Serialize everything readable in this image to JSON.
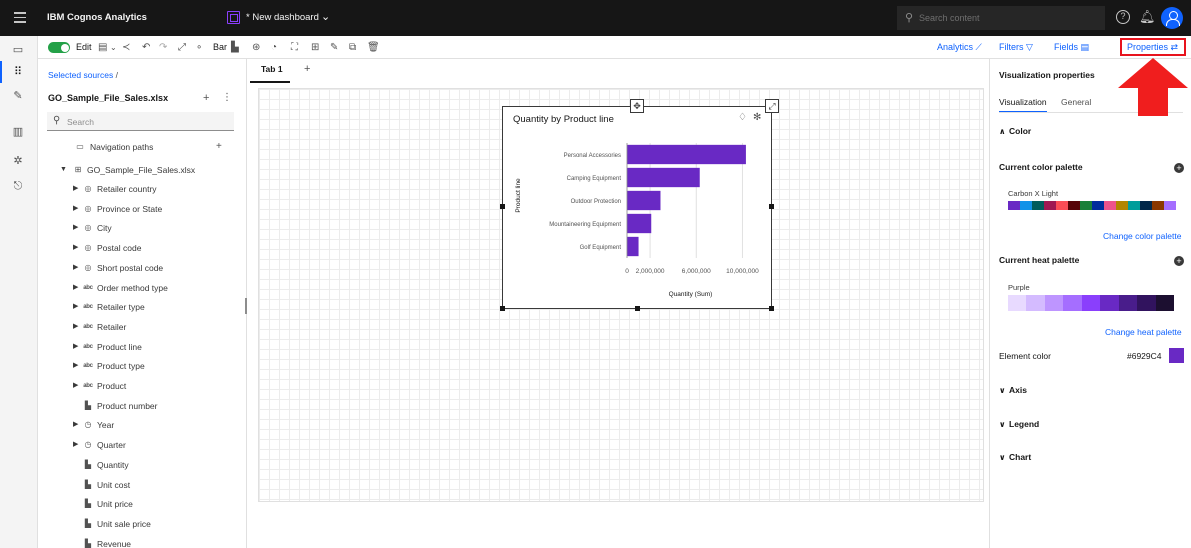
{
  "app": {
    "title": "IBM Cognos Analytics",
    "dashboard_name": "* New dashboard",
    "search_placeholder": "Search content"
  },
  "toolbar": {
    "edit_label": "Edit",
    "bar_label": "Bar",
    "analytics_label": "Analytics",
    "filters_label": "Filters",
    "fields_label": "Fields",
    "properties_label": "Properties"
  },
  "sources": {
    "breadcrumb": "Selected sources",
    "breadcrumb_sep": "/",
    "file": "GO_Sample_File_Sales.xlsx",
    "search_placeholder": "Search",
    "nav_paths": "Navigation paths",
    "root": "GO_Sample_File_Sales.xlsx",
    "items": [
      {
        "label": "Retailer country",
        "icon": "location-icon",
        "expandable": true
      },
      {
        "label": "Province or State",
        "icon": "location-icon",
        "expandable": true
      },
      {
        "label": "City",
        "icon": "location-icon",
        "expandable": true
      },
      {
        "label": "Postal code",
        "icon": "location-icon",
        "expandable": true
      },
      {
        "label": "Short postal code",
        "icon": "location-icon",
        "expandable": true
      },
      {
        "label": "Order method type",
        "icon": "text-icon",
        "expandable": true
      },
      {
        "label": "Retailer type",
        "icon": "text-icon",
        "expandable": true
      },
      {
        "label": "Retailer",
        "icon": "text-icon",
        "expandable": true
      },
      {
        "label": "Product line",
        "icon": "text-icon",
        "expandable": true
      },
      {
        "label": "Product type",
        "icon": "text-icon",
        "expandable": true
      },
      {
        "label": "Product",
        "icon": "text-icon",
        "expandable": true
      },
      {
        "label": "Product number",
        "icon": "measure-icon",
        "expandable": false
      },
      {
        "label": "Year",
        "icon": "time-icon",
        "expandable": true
      },
      {
        "label": "Quarter",
        "icon": "time-icon",
        "expandable": true
      },
      {
        "label": "Quantity",
        "icon": "measure-icon",
        "expandable": false
      },
      {
        "label": "Unit cost",
        "icon": "measure-icon",
        "expandable": false
      },
      {
        "label": "Unit price",
        "icon": "measure-icon",
        "expandable": false
      },
      {
        "label": "Unit sale price",
        "icon": "measure-icon",
        "expandable": false
      },
      {
        "label": "Revenue",
        "icon": "measure-icon",
        "expandable": false
      }
    ]
  },
  "tabs": [
    {
      "label": "Tab 1"
    }
  ],
  "chart_data": {
    "type": "bar",
    "orientation": "horizontal",
    "title": "Quantity by Product line",
    "xlabel": "Quantity (Sum)",
    "ylabel": "Product line",
    "categories": [
      "Personal Accessories",
      "Camping Equipment",
      "Outdoor Protection",
      "Mountaineering Equipment",
      "Golf Equipment"
    ],
    "values": [
      10300000,
      6300000,
      2900000,
      2100000,
      1000000
    ],
    "xlim": [
      0,
      11000000
    ],
    "xticks": [
      0,
      2000000,
      6000000,
      10000000
    ],
    "xtick_labels": [
      "0",
      "2,000,000",
      "6,000,000",
      "10,000,000"
    ],
    "grid": true,
    "color": "#6929C4"
  },
  "properties": {
    "title": "Visualization properties",
    "tabs": [
      "Visualization",
      "General"
    ],
    "color_section": "Color",
    "color_palette_label": "Current color palette",
    "color_palette_name": "Carbon X Light",
    "color_palette": [
      "#6929c4",
      "#1192e8",
      "#005d5d",
      "#9f1853",
      "#fa4d56",
      "#570408",
      "#198038",
      "#002d9c",
      "#ee538b",
      "#b28600",
      "#009d9a",
      "#012749",
      "#8a3800",
      "#a56eff"
    ],
    "change_color_palette": "Change color palette",
    "heat_palette_label": "Current heat palette",
    "heat_palette_name": "Purple",
    "heat_palette": [
      "#e8daff",
      "#d4bbff",
      "#be95ff",
      "#a56eff",
      "#8a3ffc",
      "#6929c4",
      "#491d8b",
      "#31135e",
      "#1c0f30"
    ],
    "change_heat_palette": "Change heat palette",
    "element_color_label": "Element color",
    "element_color_value": "#6929C4",
    "axis_section": "Axis",
    "legend_section": "Legend",
    "chart_section": "Chart"
  }
}
